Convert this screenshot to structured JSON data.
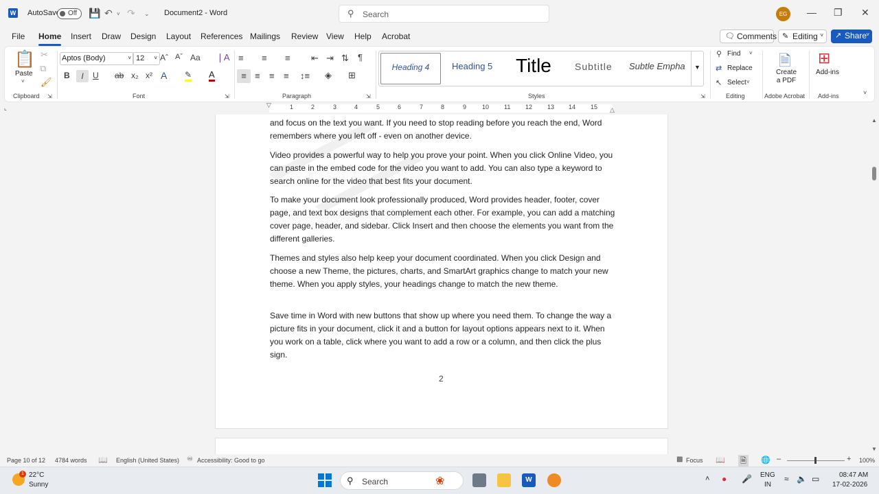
{
  "titlebar": {
    "autosave_label": "AutoSave",
    "autosave_state": "Off",
    "doc_title": "Document2 - Word",
    "search_placeholder": "Search",
    "user_initials": "EG"
  },
  "menu": {
    "tabs": [
      "File",
      "Home",
      "Insert",
      "Draw",
      "Design",
      "Layout",
      "References",
      "Mailings",
      "Review",
      "View",
      "Help",
      "Acrobat"
    ],
    "active_tab": "Home",
    "comments": "Comments",
    "editing": "Editing",
    "share": "Share"
  },
  "ribbon": {
    "paste": "Paste",
    "clipboard": "Clipboard",
    "font_name": "Aptos (Body)",
    "font_size": "12",
    "font": "Font",
    "paragraph": "Paragraph",
    "styles": "Styles",
    "style_items": [
      "Heading 4",
      "Heading 5",
      "Title",
      "Subtitle",
      "Subtle Empha"
    ],
    "find": "Find",
    "replace": "Replace",
    "select": "Select",
    "editing": "Editing",
    "create_pdf_1": "Create",
    "create_pdf_2": "a PDF",
    "adobe_acrobat": "Adobe Acrobat",
    "addins": "Add-ins",
    "addins_group": "Add-ins"
  },
  "ruler_numbers": [
    "1",
    "2",
    "3",
    "4",
    "5",
    "6",
    "7",
    "8",
    "9",
    "10",
    "11",
    "12",
    "13",
    "14",
    "15"
  ],
  "document": {
    "paragraphs": [
      "and focus on the text you want. If you need to stop reading before you reach the end, Word remembers where you left off - even on another device.",
      "Video provides a powerful way to help you prove your point. When you click Online Video, you can paste in the embed code for the video you want to add. You can also type a keyword to search online for the video that best fits your document.",
      "To make your document look professionally produced, Word provides header, footer, cover page, and text box designs that complement each other. For example, you can add a matching cover page, header, and sidebar. Click Insert and then choose the elements you want from the different galleries.",
      "Themes and styles also help keep your document coordinated. When you click Design and choose a new Theme, the pictures, charts, and SmartArt graphics change to match your new theme. When you apply styles, your headings change to match the new theme.",
      "Save time in Word with new buttons that show up where you need them. To change the way a picture fits in your document, click it and a button for layout options appears next to it. When you work on a table, click where you want to add a row or a column, and then click the plus sign."
    ],
    "page_number": "2"
  },
  "status": {
    "page": "Page 10 of 12",
    "words": "4784 words",
    "language": "English (United States)",
    "accessibility": "Accessibility: Good to go",
    "focus": "Focus",
    "zoom": "100%"
  },
  "taskbar": {
    "temp": "22°C",
    "weather": "Sunny",
    "weather_badge": "1",
    "search": "Search",
    "lang1": "ENG",
    "lang2": "IN",
    "time": "08:47 AM",
    "date": "17-02-2026"
  }
}
